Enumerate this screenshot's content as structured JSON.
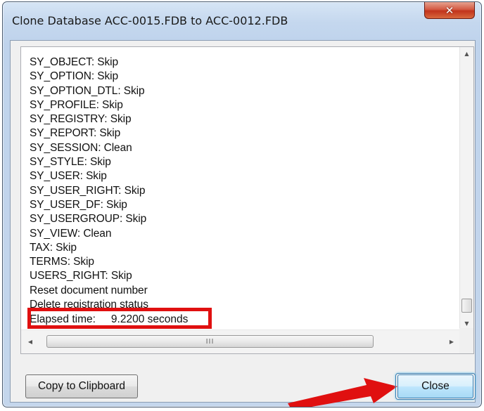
{
  "window": {
    "title": "Clone Database ACC-0015.FDB to ACC-0012.FDB",
    "close_glyph": "✕"
  },
  "log": {
    "lines": [
      "SY_OBJECT: Skip",
      "SY_OPTION: Skip",
      "SY_OPTION_DTL: Skip",
      "SY_PROFILE: Skip",
      "SY_REGISTRY: Skip",
      "SY_REPORT: Skip",
      "SY_SESSION: Clean",
      "SY_STYLE: Skip",
      "SY_USER: Skip",
      "SY_USER_RIGHT: Skip",
      "SY_USER_DF: Skip",
      "SY_USERGROUP: Skip",
      "SY_VIEW: Clean",
      "TAX: Skip",
      "TERMS: Skip",
      "USERS_RIGHT: Skip",
      "Reset document number",
      "Delete registration status"
    ],
    "elapsed_label": "Elapsed time:",
    "elapsed_value": "9.2200 seconds"
  },
  "scrollbar": {
    "h_grip": "III"
  },
  "buttons": {
    "copy_label": "Copy to Clipboard",
    "close_label": "Close"
  },
  "colors": {
    "highlight": "#e01010",
    "annotation_arrow": "#e01010"
  }
}
